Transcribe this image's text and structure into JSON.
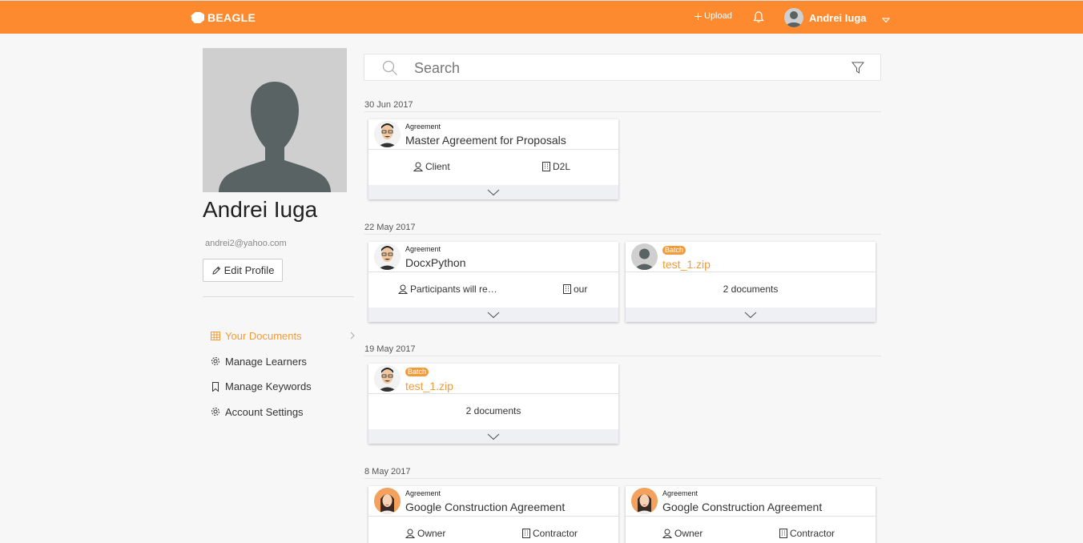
{
  "header": {
    "brand": "BEAGLE",
    "upload_label": "Upload",
    "user_name": "Andrei Iuga",
    "accent_color": "#fe8a2f"
  },
  "profile": {
    "name": "Andrei Iuga",
    "email": "andrei2@yahoo.com",
    "edit_label": "Edit Profile"
  },
  "nav": {
    "items": [
      {
        "label": "Your Documents",
        "icon": "grid-icon",
        "active": true
      },
      {
        "label": "Manage Learners",
        "icon": "gear-icon"
      },
      {
        "label": "Manage Keywords",
        "icon": "bookmark-icon"
      },
      {
        "label": "Account Settings",
        "icon": "gear-icon"
      }
    ]
  },
  "search": {
    "placeholder": "Search"
  },
  "groups": [
    {
      "date": "30 Jun 2017",
      "cards": [
        {
          "type": "Agreement",
          "title": "Master Agreement for Proposals",
          "party": "Client",
          "org": "D2L"
        }
      ]
    },
    {
      "date": "22 May 2017",
      "cards": [
        {
          "type": "Agreement",
          "title": "DocxPython",
          "party": "Participants will re…",
          "org": "our"
        },
        {
          "badge": "Batch",
          "title": "test_1.zip",
          "summary": "2 documents"
        }
      ]
    },
    {
      "date": "19 May 2017",
      "cards": [
        {
          "badge": "Batch",
          "title": "test_1.zip",
          "summary": "2 documents"
        }
      ]
    },
    {
      "date": "8 May 2017",
      "cards": [
        {
          "type": "Agreement",
          "title": "Google Construction Agreement",
          "party": "Owner",
          "org": "Contractor"
        },
        {
          "type": "Agreement",
          "title": "Google Construction Agreement",
          "party": "Owner",
          "org": "Contractor"
        }
      ]
    }
  ]
}
